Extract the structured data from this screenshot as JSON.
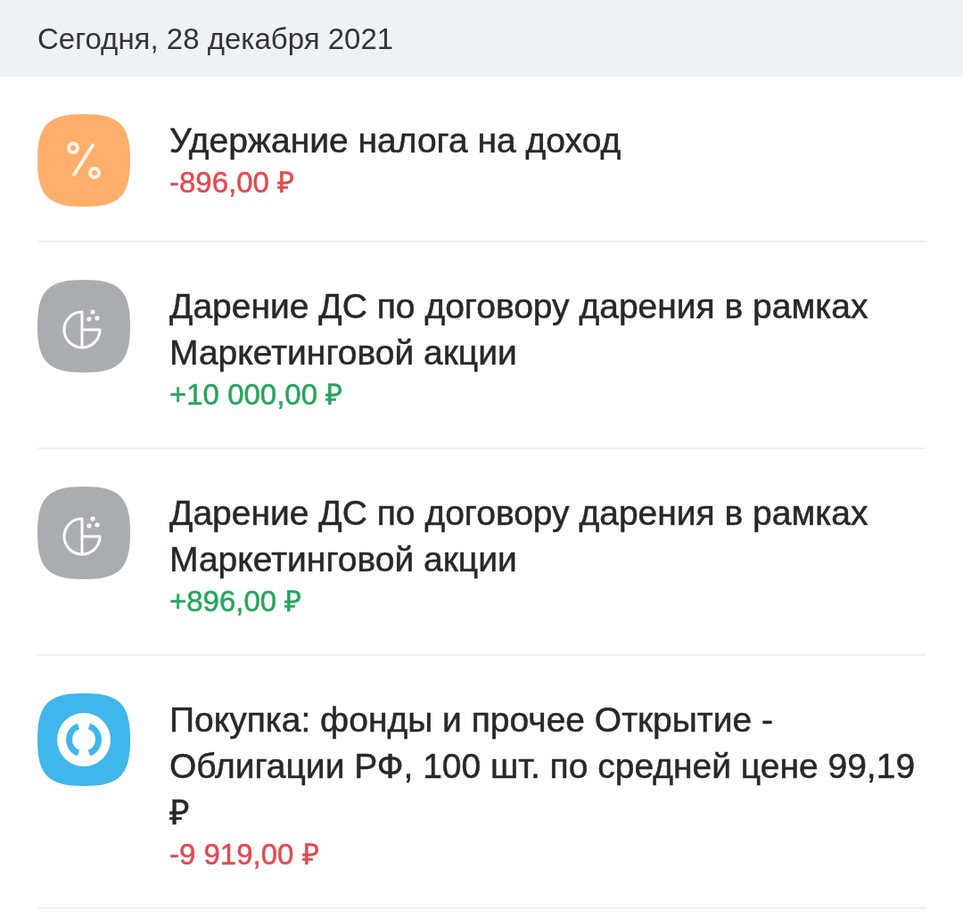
{
  "header": {
    "date": "Сегодня, 28 декабря 2021"
  },
  "transactions": [
    {
      "kind": "tax",
      "color": "#ffae6b",
      "title": "Удержание налога на доход",
      "amount": "-896,00 ₽",
      "incoming": false
    },
    {
      "kind": "gift",
      "color": "#a9acb1",
      "title": "Дарение ДС по договору дарения в рамках Маркетинговой акции",
      "amount": "+10 000,00 ₽",
      "incoming": true
    },
    {
      "kind": "gift",
      "color": "#a9acb1",
      "title": "Дарение ДС по договору дарения в рамках Маркетинговой акции",
      "amount": "+896,00 ₽",
      "incoming": true
    },
    {
      "kind": "purchase",
      "color": "#3fb6ec",
      "title": "Покупка: фонды и прочее Открытие - Облигации РФ, 100 шт. по средней цене 99,19 ₽",
      "amount": "-9 919,00 ₽",
      "incoming": false
    }
  ]
}
